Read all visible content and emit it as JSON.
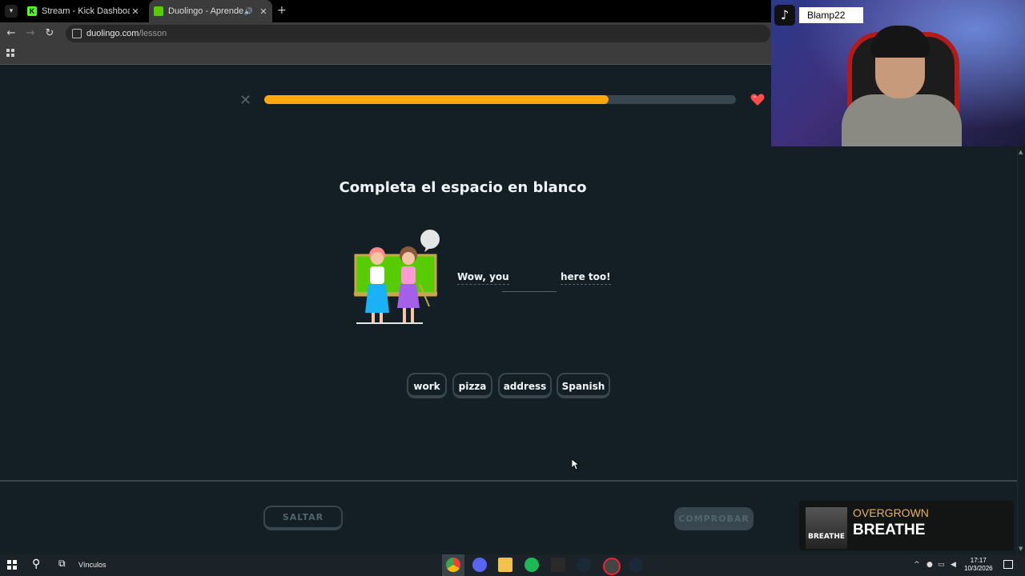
{
  "browser": {
    "tabs": [
      {
        "title": "Stream - Kick Dashboard",
        "favicon": "kick-icon",
        "active": false
      },
      {
        "title": "Duolingo - Aprende con le",
        "favicon": "duolingo-icon",
        "active": true
      }
    ],
    "new_tab_glyph": "+",
    "url_host": "duolingo.com",
    "url_path": "/lesson"
  },
  "lesson": {
    "progress_percent": 73,
    "instruction": "Completa el espacio en blanco",
    "sentence_before": "Wow, you",
    "sentence_after": "here too!",
    "word_bank": [
      "work",
      "pizza",
      "address",
      "Spanish"
    ],
    "skip_label": "SALTAR",
    "check_label": "COMPROBAR",
    "colors": {
      "progress": "#ffa80d",
      "heart": "#ff4b4b",
      "background": "#131f24"
    }
  },
  "overlay": {
    "tiktok_username": "Blamp22",
    "now_playing_artist": "OVERGROWN",
    "now_playing_song": "BREATHE",
    "album_text": "BREATHE"
  },
  "taskbar": {
    "links_label": "Vínculos",
    "time": "17:17",
    "date": "10/3/2026"
  }
}
